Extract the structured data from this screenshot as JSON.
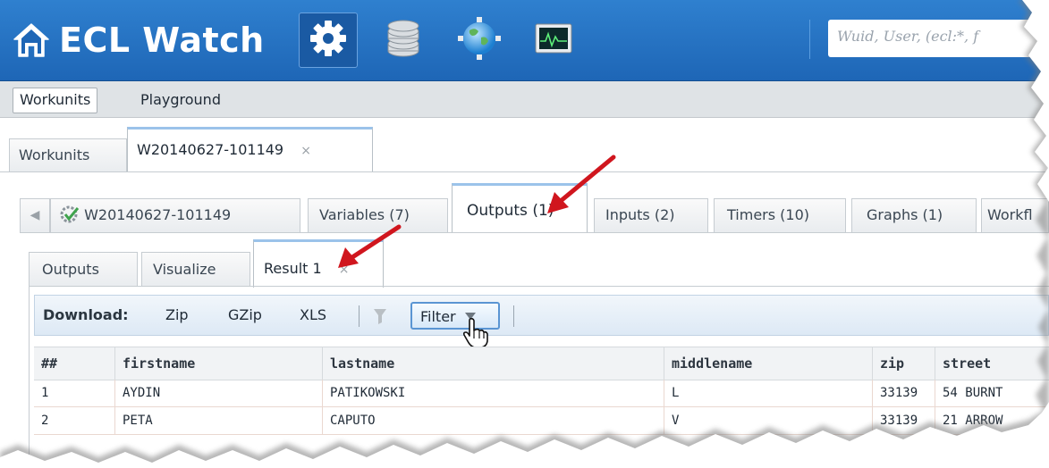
{
  "header": {
    "title": "ECL Watch",
    "icons": [
      "home-icon",
      "gear-icon",
      "database-icon",
      "globe-icon",
      "monitor-icon"
    ],
    "search_placeholder": "Wuid, User, (ecl:*, f",
    "colors": {
      "bar": "#1e66b6",
      "selected": "#1a5aa3"
    }
  },
  "mainnav": {
    "items": [
      {
        "label": "Workunits",
        "active": true
      },
      {
        "label": "Playground",
        "active": false
      }
    ]
  },
  "tabs_level1": [
    {
      "label": "Workunits"
    },
    {
      "label": "W20140627-101149",
      "close": "×",
      "selected": true
    }
  ],
  "tabs_level2": [
    {
      "label": "W20140627-101149",
      "icon": "workunit-complete-icon"
    },
    {
      "label": "Variables (7)"
    },
    {
      "label": "Outputs (1)",
      "selected": true
    },
    {
      "label": "Inputs (2)"
    },
    {
      "label": "Timers (10)"
    },
    {
      "label": "Graphs (1)"
    },
    {
      "label": "Workfl"
    }
  ],
  "tabs_level3": [
    {
      "label": "Outputs"
    },
    {
      "label": "Visualize"
    },
    {
      "label": "Result 1",
      "close": "×",
      "selected": true
    }
  ],
  "toolbar": {
    "download_label": "Download:",
    "zip": "Zip",
    "gzip": "GZip",
    "xls": "XLS",
    "filter_label": "Filter"
  },
  "grid": {
    "columns": [
      "##",
      "firstname",
      "lastname",
      "middlename",
      "zip",
      "street"
    ],
    "rows": [
      [
        "1",
        "AYDIN",
        "PATIKOWSKI",
        "L",
        "33139",
        "54 BURNT"
      ],
      [
        "2",
        "PETA",
        "CAPUTO",
        "V",
        "33139",
        "21 ARROW"
      ]
    ]
  },
  "annotation_color": "#d0161e"
}
